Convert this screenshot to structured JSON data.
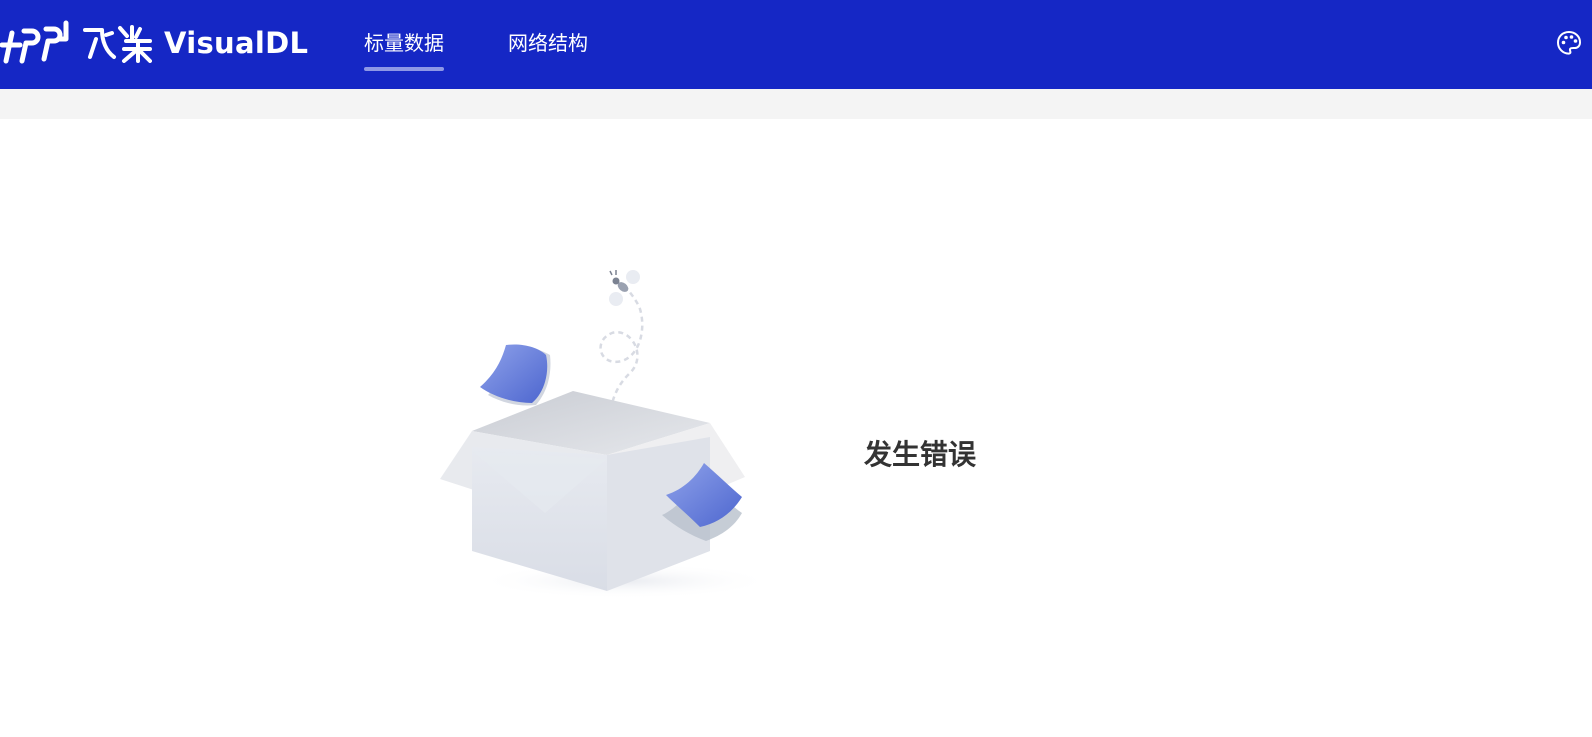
{
  "app": {
    "brand_cn": "飞桨",
    "brand_name": "VisualDL"
  },
  "nav": {
    "tabs": [
      {
        "label": "标量数据",
        "active": true
      },
      {
        "label": "网络结构",
        "active": false
      }
    ],
    "theme_icon": "palette-icon"
  },
  "main": {
    "error_message": "发生错误",
    "illustration_icon": "open-box-empty-illustration"
  },
  "colors": {
    "nav_background": "#1527c5",
    "active_indicator": "#8e98e6",
    "subbar_background": "#f4f4f4",
    "error_text": "#333333",
    "paper_blue": "#5b74d6"
  }
}
